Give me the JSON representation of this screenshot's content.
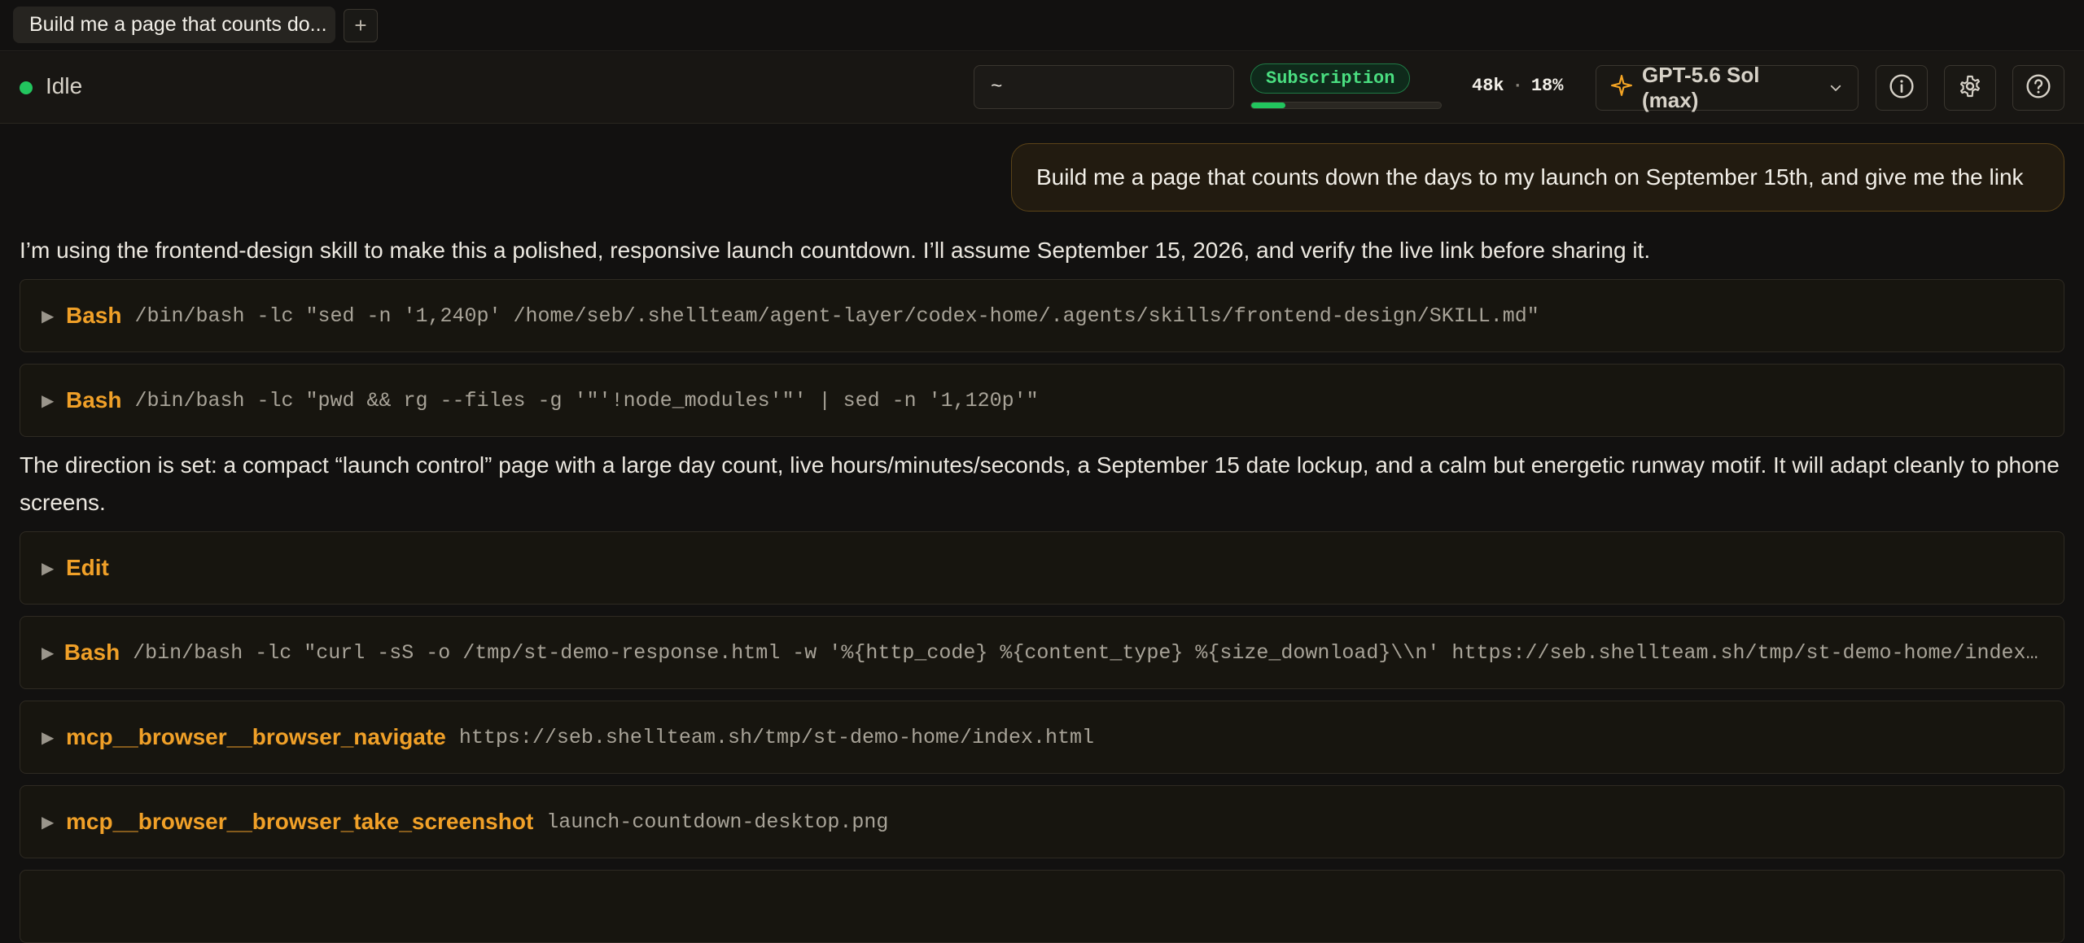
{
  "tabs": {
    "active_label": "Build me a page that counts do...",
    "new_tab_label": "+"
  },
  "status": {
    "state": "Idle",
    "cwd_value": "~",
    "plan_badge": "Subscription",
    "usage_fraction": 0.18,
    "tokens": "48k",
    "percent": "18%",
    "separator": "·",
    "model": "GPT-5.6 Sol (max)"
  },
  "icons": {
    "model": "sparkle-icon",
    "model_chevron": "chevron-down-icon",
    "info": "info-icon",
    "settings": "gear-icon",
    "help": "help-icon",
    "tool_toggle": "caret-right-icon"
  },
  "colors": {
    "accent": "#f0a028",
    "status_ok": "#22c55e",
    "badge_text": "#4ade80",
    "background": "#121110"
  },
  "conversation": {
    "user_message": "Build me a page that counts down the days to my launch on September 15th, and give me the link",
    "assistant_1": "I’m using the frontend-design skill to make this a polished, responsive launch countdown. I’ll assume September 15, 2026, and verify the live link before sharing it.",
    "assistant_2": "The direction is set: a compact “launch control” page with a large day count, live hours/minutes/seconds, a September 15 date lockup, and a calm but energetic runway motif. It will adapt cleanly to phone screens.",
    "tools": [
      {
        "name": "Bash",
        "arg": "/bin/bash -lc \"sed -n '1,240p' /home/seb/.shellteam/agent-layer/codex-home/.agents/skills/frontend-design/SKILL.md\""
      },
      {
        "name": "Bash",
        "arg": "/bin/bash -lc \"pwd && rg --files -g '\"'!node_modules'\"' | sed -n '1,120p'\""
      },
      {
        "name": "Edit",
        "arg": ""
      },
      {
        "name": "Bash",
        "arg": "/bin/bash -lc \"curl -sS -o /tmp/st-demo-response.html -w '%{http_code} %{content_type} %{size_download}\\\\n' https://seb.shellteam.sh/tmp/st-demo-home/index.html && rg..."
      },
      {
        "name": "mcp__browser__browser_navigate",
        "arg": "https://seb.shellteam.sh/tmp/st-demo-home/index.html"
      },
      {
        "name": "mcp__browser__browser_take_screenshot",
        "arg": "launch-countdown-desktop.png"
      }
    ]
  }
}
